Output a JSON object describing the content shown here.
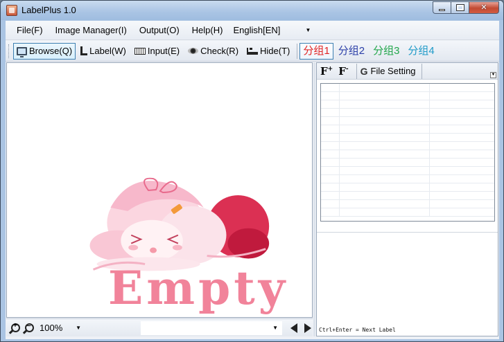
{
  "window": {
    "title": "LabelPlus 1.0",
    "minimize": "",
    "close_glyph": "✕"
  },
  "menu": {
    "file": "File(F)",
    "image_manager": "Image Manager(I)",
    "output": "Output(O)",
    "help": "Help(H)",
    "language": "English[EN]"
  },
  "toolbar": {
    "browse": "Browse(Q)",
    "label": "Label(W)",
    "input": "Input(E)",
    "check": "Check(R)",
    "hide": "Hide(T)",
    "groups": [
      {
        "label": "分组1",
        "color": "#e02424"
      },
      {
        "label": "分组2",
        "color": "#2b3fa8"
      },
      {
        "label": "分组3",
        "color": "#21a64a"
      },
      {
        "label": "分组4",
        "color": "#1e9ac8"
      }
    ]
  },
  "image_panel": {
    "empty_text": "Empty"
  },
  "zoombar": {
    "zoom_level": "100%"
  },
  "right_panel": {
    "file_setting": "File Setting",
    "hint": "Ctrl+Enter = Next Label"
  },
  "colors": {
    "accent": "#3c7fb1",
    "empty_text": "#f1839a"
  }
}
